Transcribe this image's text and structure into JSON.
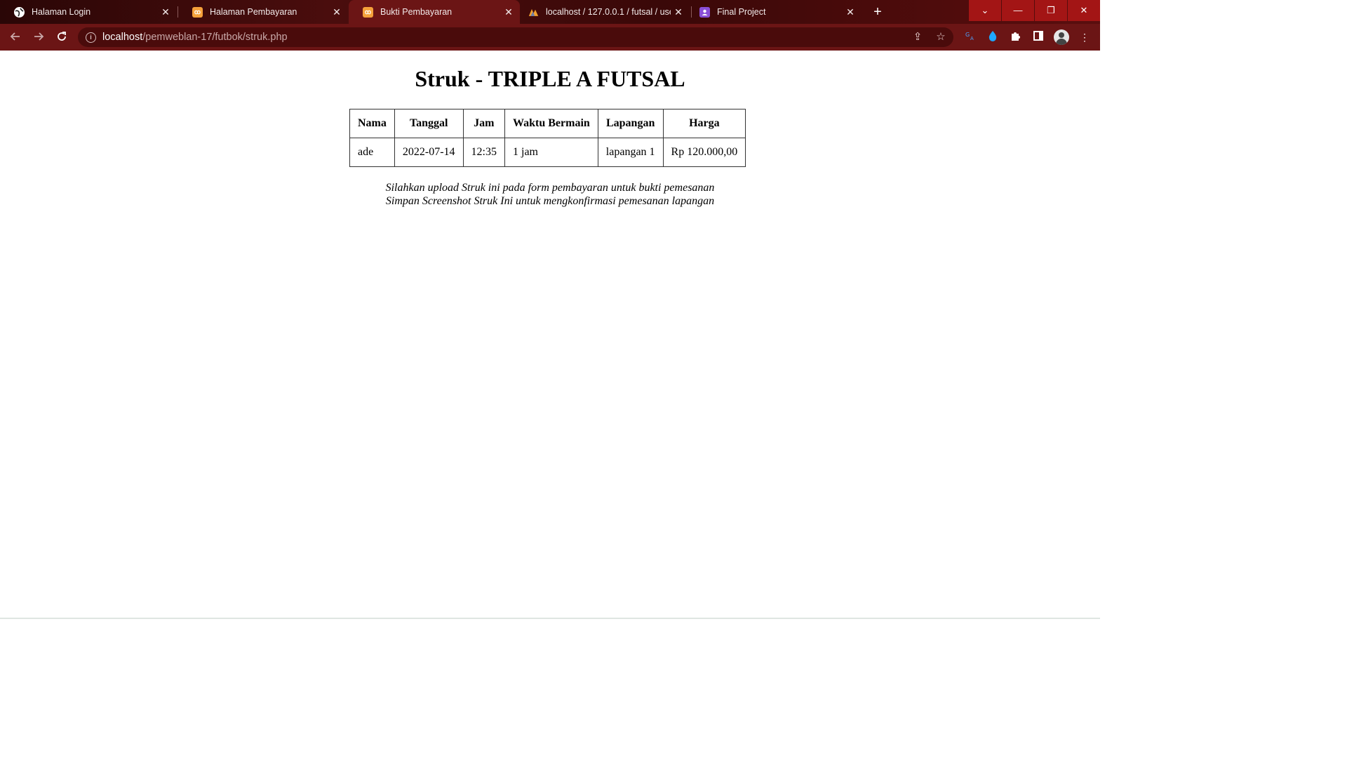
{
  "browser": {
    "tabs": [
      {
        "title": "Halaman Login",
        "icon": "globe-icon",
        "active": false
      },
      {
        "title": "Halaman Pembayaran",
        "icon": "xampp-icon",
        "active": false
      },
      {
        "title": "Bukti Pembayaran",
        "icon": "xampp-icon",
        "active": true
      },
      {
        "title": "localhost / 127.0.0.1 / futsal / user",
        "icon": "phpmyadmin-icon",
        "active": false
      },
      {
        "title": "Final Project",
        "icon": "classroom-icon",
        "active": false
      }
    ],
    "url_host": "localhost",
    "url_path": "/pemweblan-17/futbok/struk.php",
    "colors": {
      "toolbar": "#6b1515",
      "omnibox": "#4a0b0b",
      "close_button": "#a31515"
    }
  },
  "page": {
    "title": "Struk - TRIPLE A FUTSAL",
    "table": {
      "headers": [
        "Nama",
        "Tanggal",
        "Jam",
        "Waktu Bermain",
        "Lapangan",
        "Harga"
      ],
      "rows": [
        [
          "ade",
          "2022-07-14",
          "12:35",
          "1 jam",
          "lapangan 1",
          "Rp 120.000,00"
        ]
      ]
    },
    "notes": [
      "Silahkan upload Struk ini pada form pembayaran untuk bukti pemesanan",
      "Simpan Screenshot Struk Ini untuk mengkonfirmasi pemesanan lapangan"
    ]
  }
}
